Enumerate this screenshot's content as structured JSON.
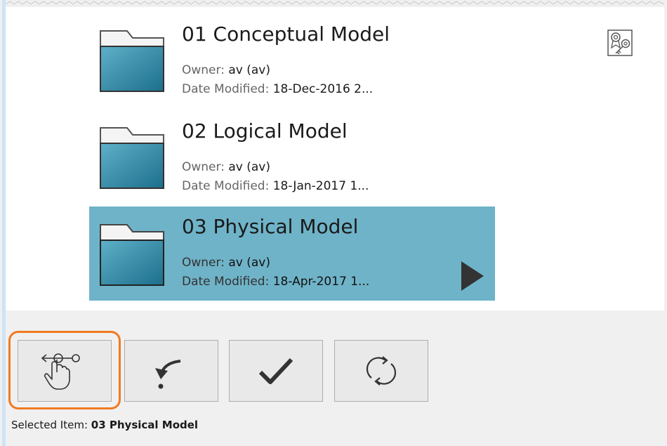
{
  "items": [
    {
      "title": "01 Conceptual Model",
      "owner_label": "Owner:",
      "owner_value": "av (av)",
      "date_label": "Date Modified:",
      "date_value": "18-Dec-2016 2..."
    },
    {
      "title": "02 Logical Model",
      "owner_label": "Owner:",
      "owner_value": "av (av)",
      "date_label": "Date Modified:",
      "date_value": "18-Jan-2017 1..."
    },
    {
      "title": "03 Physical Model",
      "owner_label": "Owner:",
      "owner_value": "av (av)",
      "date_label": "Date Modified:",
      "date_value": "18-Apr-2017 1..."
    }
  ],
  "icons": {
    "folder": "folder-icon",
    "certificate": "certificate-icon",
    "expand": "expand-arrow-icon",
    "touch": "touch-gesture-icon",
    "undo": "undo-icon",
    "check": "checkmark-icon",
    "refresh": "refresh-icon"
  },
  "colors": {
    "selected_background": "#6fb3c8",
    "highlight_ring": "#f07a22",
    "folder_fill": "#2f8aa6"
  },
  "status": {
    "label": "Selected Item:",
    "value": "03 Physical Model"
  }
}
